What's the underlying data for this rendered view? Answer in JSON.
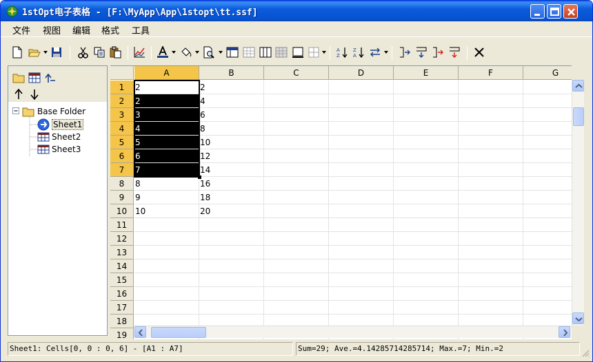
{
  "window": {
    "title": "1stOpt电子表格 - [F:\\MyApp\\App\\1stopt\\tt.ssf]"
  },
  "menu": [
    "文件",
    "视图",
    "编辑",
    "格式",
    "工具"
  ],
  "toolbar": {
    "icons": [
      "new-icon",
      "open-icon",
      "save-icon",
      "cut-icon",
      "copy-icon",
      "paste-icon",
      "chart-icon",
      "font-color-icon",
      "fill-color-icon",
      "print-preview-icon",
      "border-grid-icon",
      "sort-asc-icon",
      "sort-desc-icon",
      "delete-icon"
    ]
  },
  "tree": {
    "root": "Base Folder",
    "sheets": [
      "Sheet1",
      "Sheet2",
      "Sheet3"
    ],
    "selected": "Sheet1"
  },
  "grid": {
    "columns": [
      "A",
      "B",
      "C",
      "D",
      "E",
      "F",
      "G"
    ],
    "rows": [
      "1",
      "2",
      "3",
      "4",
      "5",
      "6",
      "7",
      "8",
      "9",
      "10",
      "11",
      "12",
      "13",
      "14",
      "15",
      "16",
      "17",
      "18",
      "19"
    ],
    "colA": [
      "2",
      "2",
      "3",
      "4",
      "5",
      "6",
      "7",
      "8",
      "9",
      "10"
    ],
    "colB": [
      "2",
      "4",
      "6",
      "8",
      "10",
      "12",
      "14",
      "16",
      "18",
      "20"
    ],
    "selected_rows": [
      "1",
      "2",
      "3",
      "4",
      "5",
      "6",
      "7"
    ],
    "selected_column": "A"
  },
  "status": {
    "cells": "Sheet1: Cells[0, 0 : 0, 6] - [A1 : A7]",
    "stats": "Sum=29; Ave.=4.14285714285714; Max.=7; Min.=2"
  },
  "colors": {
    "title_bar": "#0a5cdc",
    "selection_header": "#f4c549",
    "selected_fill": "#000000"
  }
}
